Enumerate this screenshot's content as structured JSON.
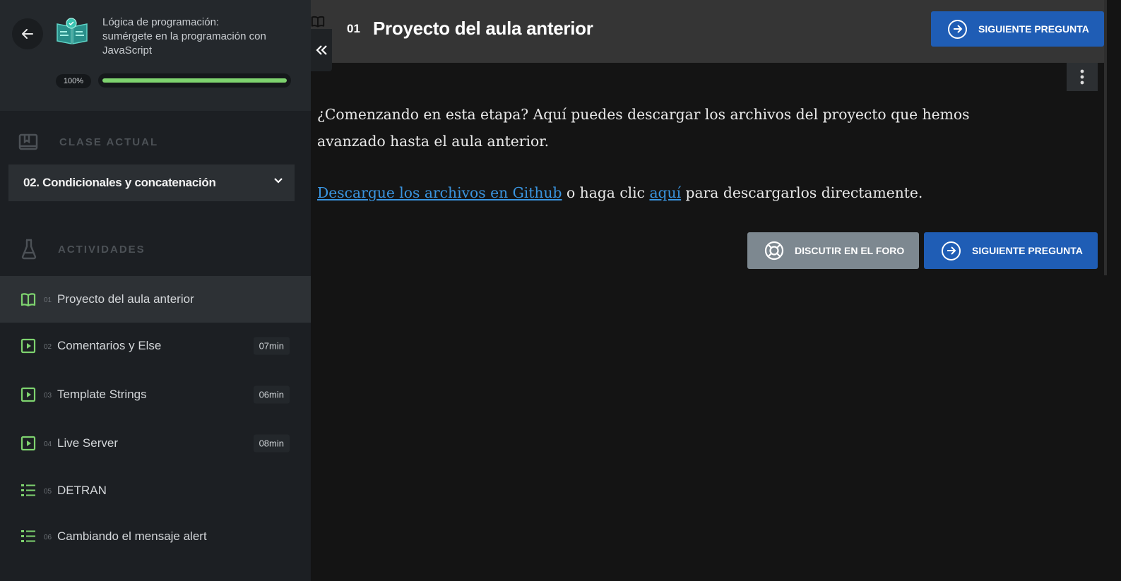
{
  "sidebar": {
    "course_title": "Lógica de programación: sumérgete en la programación con JavaScript",
    "progress_label": "100%",
    "progress_value": 1.0,
    "clase_actual_label": "CLASE ACTUAL",
    "clase_select": "02. Condicionales y concatenación",
    "actividades_label": "ACTIVIDADES",
    "activities": [
      {
        "num": "01",
        "title": "Proyecto del aula anterior",
        "duration": "",
        "icon": "book-icon"
      },
      {
        "num": "02",
        "title": "Comentarios y Else",
        "duration": "07min",
        "icon": "play-icon"
      },
      {
        "num": "03",
        "title": "Template Strings",
        "duration": "06min",
        "icon": "play-icon"
      },
      {
        "num": "04",
        "title": "Live Server",
        "duration": "08min",
        "icon": "play-icon"
      },
      {
        "num": "05",
        "title": "DETRAN",
        "duration": "",
        "icon": "list-icon"
      },
      {
        "num": "06",
        "title": "Cambiando el mensaje alert",
        "duration": "",
        "icon": "list-icon"
      }
    ]
  },
  "header": {
    "number": "01",
    "title": "Proyecto del aula anterior",
    "next_label": "SIGUIENTE PREGUNTA"
  },
  "content": {
    "paragraph1": "¿Comenzando en esta etapa? Aquí puedes descargar los archivos del proyecto que hemos avanzado hasta el aula anterior.",
    "link_github": "Descargue los archivos en Github",
    "text_middle": " o haga clic ",
    "link_aqui": "aquí",
    "text_end": " para descargarlos directamente."
  },
  "actions": {
    "forum_label": "DISCUTIR EN EL FORO",
    "next_label": "SIGUIENTE PREGUNTA"
  },
  "colors": {
    "accent_green": "#7ed36f",
    "button_blue": "#1f5db5",
    "link_blue": "#3a95e0"
  }
}
